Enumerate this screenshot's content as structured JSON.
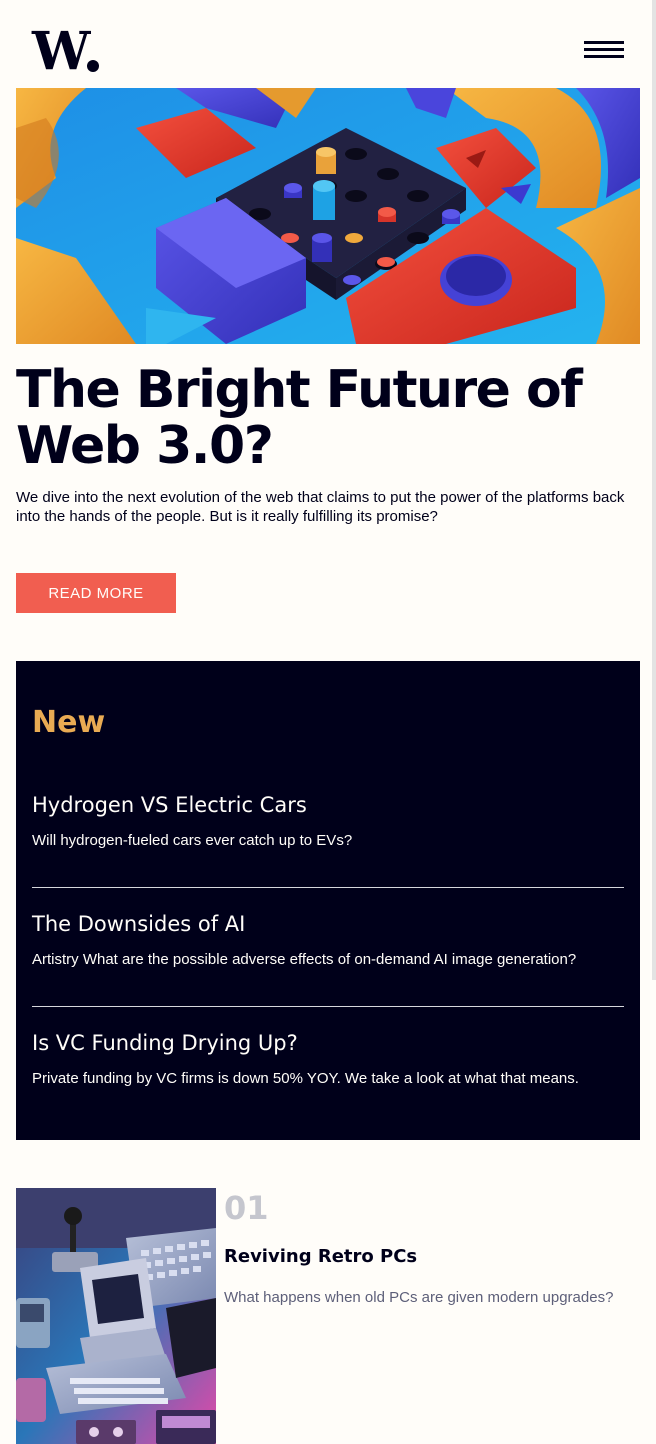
{
  "header": {
    "logo_text": "W",
    "menu_icon": "hamburger-menu-icon"
  },
  "hero": {
    "image": "abstract-3d-shapes-image",
    "title": "The Bright Future of Web 3.0?",
    "description": "We dive into the next evolution of the web that claims to put the power of the platforms back into the hands of the people. But is it really fulfilling its promise?",
    "button_label": "Read more"
  },
  "new_section": {
    "heading": "New",
    "items": [
      {
        "title": "Hydrogen VS Electric Cars",
        "description": "Will hydrogen-fueled cars ever catch up to EVs?"
      },
      {
        "title": "The Downsides of AI",
        "description": "Artistry What are the possible adverse effects of on-demand AI image generation?"
      },
      {
        "title": "Is VC Funding Drying Up?",
        "description": "Private funding by VC firms is down 50% YOY. We take a look at what that means."
      }
    ]
  },
  "articles": [
    {
      "number": "01",
      "title": "Reviving Retro PCs",
      "description": "What happens when old PCs are given modern upgrades?",
      "image": "retro-pc-image"
    }
  ],
  "colors": {
    "background": "#fffdf9",
    "dark": "#00001a",
    "accent_red": "#f15e50",
    "accent_orange": "#e9ab53",
    "muted": "#5d5f79"
  }
}
